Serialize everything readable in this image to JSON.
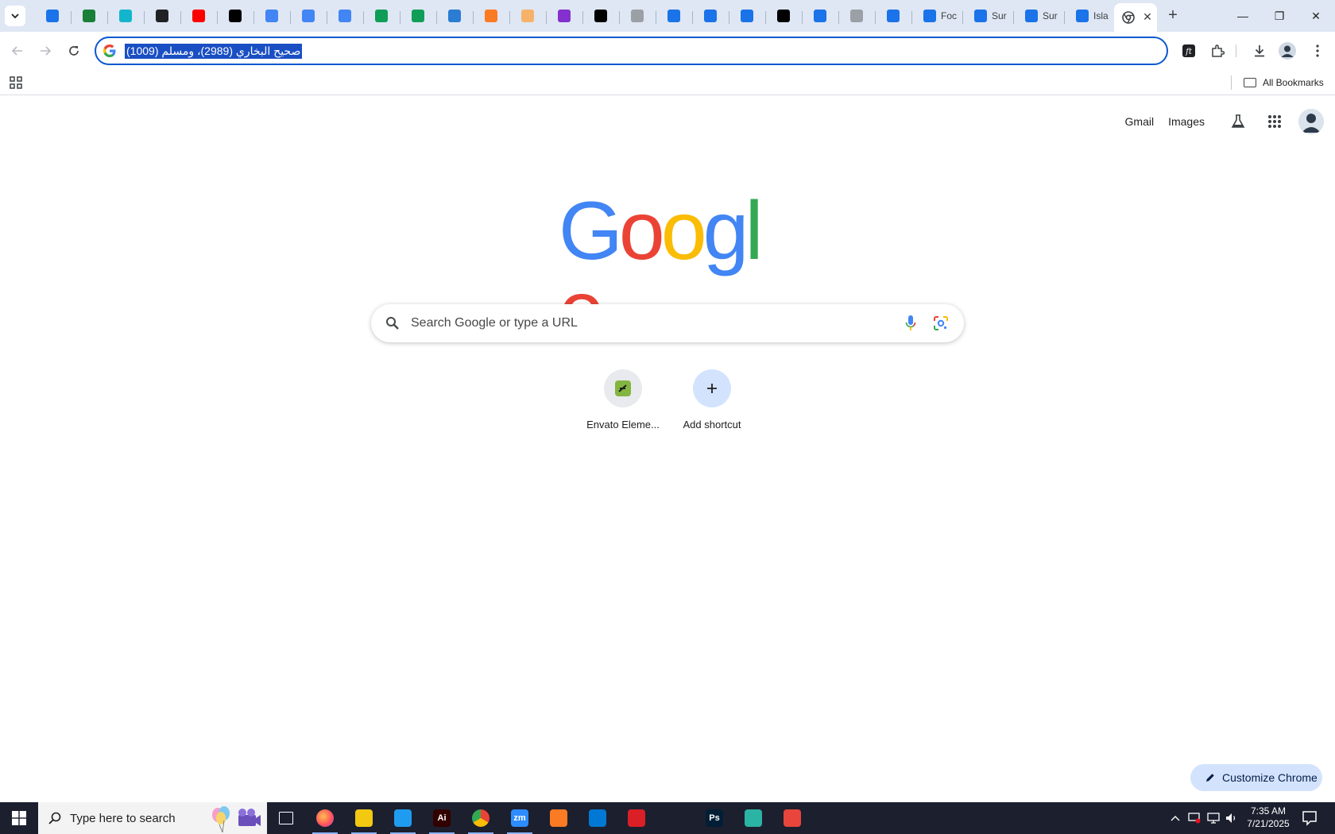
{
  "tabs": [
    {
      "icon": "bulb-icon",
      "color": "#1a73e8",
      "title": ""
    },
    {
      "icon": "vector-icon",
      "color": "#188038",
      "title": ""
    },
    {
      "icon": "hexagon-icon",
      "color": "#12b5cb",
      "title": ""
    },
    {
      "icon": "openai-icon",
      "color": "#202124",
      "title": ""
    },
    {
      "icon": "youtube-icon",
      "color": "#ff0000",
      "title": ""
    },
    {
      "icon": "bolt-icon",
      "color": "#000000",
      "title": ""
    },
    {
      "icon": "docs-icon",
      "color": "#4285f4",
      "title": ""
    },
    {
      "icon": "docs-icon",
      "color": "#4285f4",
      "title": ""
    },
    {
      "icon": "docs-icon",
      "color": "#4285f4",
      "title": ""
    },
    {
      "icon": "sheets-icon",
      "color": "#0f9d58",
      "title": ""
    },
    {
      "icon": "sheets-icon",
      "color": "#0f9d58",
      "title": ""
    },
    {
      "icon": "word-icon",
      "color": "#2b7cd3",
      "title": ""
    },
    {
      "icon": "xampp-icon",
      "color": "#fb7a24",
      "title": ""
    },
    {
      "icon": "vue-icon",
      "color": "#f6b26b",
      "title": ""
    },
    {
      "icon": "json-icon",
      "color": "#8430ce",
      "title": ""
    },
    {
      "icon": "nextjs-icon",
      "color": "#000000",
      "title": ""
    },
    {
      "icon": "grid-icon",
      "color": "#9aa0a6",
      "title": ""
    },
    {
      "icon": "forms-icon",
      "color": "#1a73e8",
      "title": ""
    },
    {
      "icon": "forms-icon",
      "color": "#1a73e8",
      "title": ""
    },
    {
      "icon": "forms-icon",
      "color": "#1a73e8",
      "title": ""
    },
    {
      "icon": "medium-icon",
      "color": "#000000",
      "title": ""
    },
    {
      "icon": "forms-icon",
      "color": "#1a73e8",
      "title": ""
    },
    {
      "icon": "globe-icon",
      "color": "#9aa0a6",
      "title": ""
    },
    {
      "icon": "forms-icon",
      "color": "#1a73e8",
      "title": ""
    },
    {
      "icon": "forms-icon",
      "color": "#1a73e8",
      "title": "Foc"
    },
    {
      "icon": "forms-icon",
      "color": "#1a73e8",
      "title": "Sur"
    },
    {
      "icon": "forms-icon",
      "color": "#1a73e8",
      "title": "Sur"
    },
    {
      "icon": "forms-icon",
      "color": "#1a73e8",
      "title": "Isla"
    }
  ],
  "window_controls": {
    "minimize": "—",
    "restore": "❐",
    "close": "✕"
  },
  "omnibox": {
    "text": "صحيح البخاري (2989)، ومسلم (1009)"
  },
  "bookmarks": {
    "all_label": "All Bookmarks"
  },
  "top_links": {
    "gmail": "Gmail",
    "images": "Images"
  },
  "logo": {
    "letters": [
      "G",
      "o",
      "o",
      "g",
      "l",
      "e"
    ],
    "colors": [
      "#4285f4",
      "#ea4335",
      "#fbbc05",
      "#4285f4",
      "#34a853",
      "#ea4335"
    ]
  },
  "search": {
    "placeholder": "Search Google or type a URL"
  },
  "shortcuts": [
    {
      "label": "Envato Eleme...",
      "icon": "envato-icon"
    },
    {
      "label": "Add shortcut",
      "icon": "plus-icon"
    }
  ],
  "customize": {
    "label": "Customize Chrome"
  },
  "taskbar": {
    "search_placeholder": "Type here to search",
    "apps": [
      {
        "name": "task-view",
        "label": "",
        "color": "#1c1f2e"
      },
      {
        "name": "firefox",
        "label": "",
        "color": "#ff7139"
      },
      {
        "name": "file-explorer",
        "label": "",
        "color": "#f2c811"
      },
      {
        "name": "vscode",
        "label": "",
        "color": "#1f9cf0"
      },
      {
        "name": "illustrator",
        "label": "Ai",
        "color": "#330000"
      },
      {
        "name": "chrome",
        "label": "",
        "color": "#4285f4"
      },
      {
        "name": "zoom",
        "label": "zm",
        "color": "#2d8cff"
      },
      {
        "name": "xampp",
        "label": "",
        "color": "#fb7a24"
      },
      {
        "name": "outlook",
        "label": "",
        "color": "#0078d4"
      },
      {
        "name": "creative-cloud",
        "label": "",
        "color": "#da1f26"
      },
      {
        "name": "pen-tool",
        "label": "",
        "color": "#1c1f2e"
      },
      {
        "name": "photoshop",
        "label": "Ps",
        "color": "#001e36"
      },
      {
        "name": "app-diamond",
        "label": "",
        "color": "#2bb3a3"
      },
      {
        "name": "scissor-app",
        "label": "",
        "color": "#e8453c"
      }
    ],
    "time": "7:35 AM",
    "date": "7/21/2025"
  }
}
